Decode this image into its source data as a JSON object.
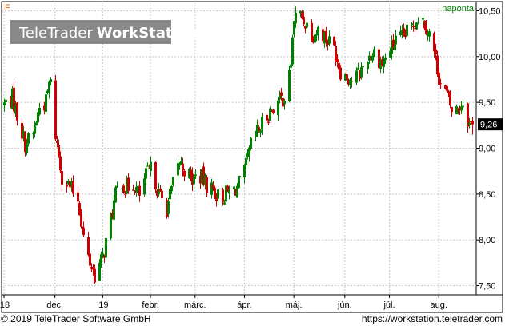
{
  "chart": {
    "symbol": "F",
    "interval": "naponta",
    "watermark": {
      "brand": "TeleTrader",
      "product": "WorkStation"
    },
    "last_value_label": "9,26",
    "footer": {
      "copyright": "© 2019 TeleTrader Software GmbH",
      "url": "https://workstation.teletrader.com"
    }
  },
  "colors": {
    "up": "#008000",
    "down": "#cc0000",
    "last_tag_bg": "#000000",
    "grid": "#c8c8c8",
    "symbol": "#e06000",
    "interval": "#008000"
  },
  "chart_data": {
    "type": "candlestick",
    "title": "",
    "grid": true,
    "y_axis": {
      "position": "right",
      "range": [
        7.4,
        10.6
      ],
      "ticks": [
        10.5,
        10.0,
        9.5,
        9.0,
        8.5,
        8.0,
        7.5
      ],
      "tick_labels": [
        "10,50",
        "10,00",
        "9,50",
        "9,00",
        "8,50",
        "8,00",
        "7,50"
      ]
    },
    "x_axis": {
      "range": [
        "2018-11-01",
        "2019-08-22"
      ],
      "ticks": [
        {
          "date": "2018-11-01",
          "label": "'18"
        },
        {
          "date": "2018-12-03",
          "label": "dec."
        },
        {
          "date": "2019-01-02",
          "label": "'19"
        },
        {
          "date": "2019-02-01",
          "label": "febr."
        },
        {
          "date": "2019-03-01",
          "label": "márc."
        },
        {
          "date": "2019-04-01",
          "label": "ápr."
        },
        {
          "date": "2019-05-02",
          "label": "máj."
        },
        {
          "date": "2019-06-03",
          "label": "jún."
        },
        {
          "date": "2019-07-01",
          "label": "júl."
        },
        {
          "date": "2019-08-01",
          "label": "aug."
        }
      ]
    },
    "last_value": 9.26,
    "series": [
      {
        "trend_close": [
          [
            "2018-11-01",
            9.48
          ],
          [
            "2018-11-06",
            9.55
          ],
          [
            "2018-11-10",
            9.3
          ],
          [
            "2018-11-14",
            9.05
          ],
          [
            "2018-11-19",
            9.15
          ],
          [
            "2018-11-23",
            9.45
          ],
          [
            "2018-11-27",
            9.5
          ],
          [
            "2018-11-29",
            9.7
          ],
          [
            "2018-12-01",
            9.7
          ],
          [
            "2018-12-03",
            9.15
          ],
          [
            "2018-12-07",
            8.7
          ],
          [
            "2018-12-13",
            8.55
          ],
          [
            "2018-12-17",
            8.45
          ],
          [
            "2018-12-20",
            8.1
          ],
          [
            "2018-12-24",
            7.8
          ],
          [
            "2018-12-28",
            7.62
          ],
          [
            "2019-01-02",
            7.8
          ],
          [
            "2019-01-05",
            8.05
          ],
          [
            "2019-01-09",
            8.4
          ],
          [
            "2019-01-13",
            8.7
          ],
          [
            "2019-01-16",
            8.55
          ],
          [
            "2019-01-21",
            8.62
          ],
          [
            "2019-01-25",
            8.48
          ],
          [
            "2019-01-29",
            8.7
          ],
          [
            "2019-02-02",
            8.78
          ],
          [
            "2019-02-06",
            8.5
          ],
          [
            "2019-02-11",
            8.35
          ],
          [
            "2019-02-15",
            8.6
          ],
          [
            "2019-02-19",
            8.85
          ],
          [
            "2019-02-23",
            8.75
          ],
          [
            "2019-02-27",
            8.65
          ],
          [
            "2019-03-03",
            8.72
          ],
          [
            "2019-03-07",
            8.62
          ],
          [
            "2019-03-12",
            8.55
          ],
          [
            "2019-03-16",
            8.45
          ],
          [
            "2019-03-20",
            8.5
          ],
          [
            "2019-03-25",
            8.55
          ],
          [
            "2019-03-29",
            8.6
          ],
          [
            "2019-04-02",
            8.8
          ],
          [
            "2019-04-06",
            9.1
          ],
          [
            "2019-04-10",
            9.2
          ],
          [
            "2019-04-15",
            9.35
          ],
          [
            "2019-04-19",
            9.45
          ],
          [
            "2019-04-25",
            9.55
          ],
          [
            "2019-04-28",
            9.6
          ],
          [
            "2019-04-30",
            9.95
          ],
          [
            "2019-05-02",
            10.42
          ],
          [
            "2019-05-06",
            10.45
          ],
          [
            "2019-05-10",
            10.35
          ],
          [
            "2019-05-14",
            10.25
          ],
          [
            "2019-05-18",
            10.3
          ],
          [
            "2019-05-22",
            10.2
          ],
          [
            "2019-05-27",
            10.1
          ],
          [
            "2019-05-31",
            9.85
          ],
          [
            "2019-06-03",
            9.8
          ],
          [
            "2019-06-07",
            9.75
          ],
          [
            "2019-06-12",
            9.82
          ],
          [
            "2019-06-17",
            10.0
          ],
          [
            "2019-06-21",
            10.05
          ],
          [
            "2019-06-26",
            9.92
          ],
          [
            "2019-06-30",
            10.05
          ],
          [
            "2019-07-04",
            10.15
          ],
          [
            "2019-07-09",
            10.2
          ],
          [
            "2019-07-14",
            10.3
          ],
          [
            "2019-07-19",
            10.45
          ],
          [
            "2019-07-23",
            10.38
          ],
          [
            "2019-07-26",
            10.25
          ],
          [
            "2019-07-29",
            10.05
          ],
          [
            "2019-08-02",
            9.7
          ],
          [
            "2019-08-06",
            9.58
          ],
          [
            "2019-08-10",
            9.35
          ],
          [
            "2019-08-13",
            9.45
          ],
          [
            "2019-08-16",
            9.5
          ],
          [
            "2019-08-20",
            9.26
          ]
        ]
      }
    ]
  }
}
